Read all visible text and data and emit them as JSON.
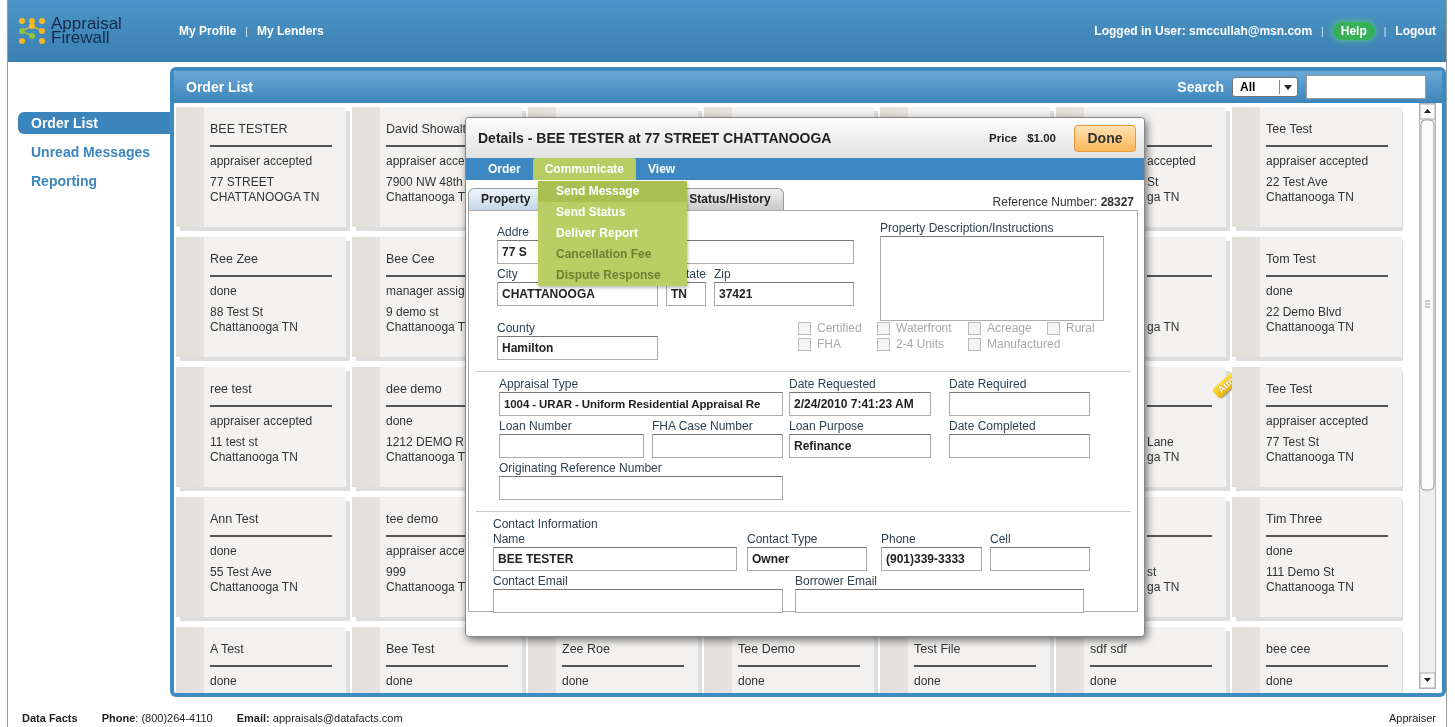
{
  "header": {
    "logo": {
      "lines": [
        "Appraisal",
        "Firewall"
      ]
    },
    "nav": [
      {
        "kind": "link",
        "label": "My Profile"
      },
      {
        "kind": "separator",
        "label": "|"
      },
      {
        "kind": "link",
        "label": "My Lenders"
      }
    ],
    "user": [
      {
        "kind": "text",
        "label": "Logged in User: smccullah@msn.com"
      },
      {
        "kind": "separator",
        "label": "|"
      },
      {
        "kind": "link",
        "label": "Help",
        "highlighted": true
      },
      {
        "kind": "separator",
        "label": "|"
      },
      {
        "kind": "link",
        "label": "Logout",
        "highlighted": false
      }
    ]
  },
  "sidebar": {
    "items": [
      {
        "label": "Order List",
        "selected": true
      },
      {
        "label": "Unread Messages",
        "selected": false
      },
      {
        "label": "Reporting",
        "selected": false
      }
    ]
  },
  "order_list": {
    "title": "Order List",
    "search": {
      "label": "Search",
      "filter": "All"
    },
    "rows": [
      {
        "cards": [
          {
            "kind": "full",
            "name": "BEE TESTER",
            "status": "appraiser accepted",
            "address": "77 STREET",
            "city": "CHATTANOOGA TN"
          },
          {
            "kind": "cut_right",
            "name": "David Showalt",
            "status": "appraiser acce",
            "address": "7900 NW 48th",
            "city": "Chattanooga T"
          },
          {
            "kind": "peek"
          },
          {
            "kind": "peek"
          },
          {
            "kind": "peek"
          },
          {
            "kind": "cut_left",
            "status": "accepted",
            "address": "St",
            "city": "ga TN"
          },
          {
            "kind": "full",
            "name": "Tee Test",
            "status": "appraiser accepted",
            "address": "22 Test Ave",
            "city": "Chattanooga TN"
          }
        ]
      },
      {
        "cards": [
          {
            "kind": "full",
            "name": "Ree Zee",
            "status": "done",
            "address": "88 Test St",
            "city": "Chattanooga TN"
          },
          {
            "kind": "cut_right",
            "name": "Bee Cee",
            "status": "manager assig",
            "address": "9 demo st",
            "city": "Chattanooga T"
          },
          {
            "kind": "covered"
          },
          {
            "kind": "covered"
          },
          {
            "kind": "covered"
          },
          {
            "kind": "cut_left",
            "city": "ga TN"
          },
          {
            "kind": "full",
            "name": "Tom Test",
            "status": "done",
            "address": "22 Demo Blvd",
            "city": "Chattanooga TN"
          }
        ]
      },
      {
        "cards": [
          {
            "kind": "full",
            "name": "ree test",
            "status": "appraiser accepted",
            "address": "11 test st",
            "city": "Chattanooga TN"
          },
          {
            "kind": "cut_right",
            "name": "dee demo",
            "status": "done",
            "address": "1212 DEMO R",
            "city": "Chattanooga T"
          },
          {
            "kind": "covered"
          },
          {
            "kind": "covered"
          },
          {
            "kind": "covered"
          },
          {
            "kind": "cut_left",
            "address": "Lane",
            "city": "ga TN",
            "badge": "Attn"
          },
          {
            "kind": "full",
            "name": "Tee Test",
            "status": "appraiser accepted",
            "address": "77 Test St",
            "city": "Chattanooga TN"
          }
        ]
      },
      {
        "cards": [
          {
            "kind": "full",
            "name": "Ann Test",
            "status": "done",
            "address": "55 Test Ave",
            "city": "Chattanooga TN"
          },
          {
            "kind": "cut_right",
            "name": "tee demo",
            "status": "appraiser acce",
            "address": "999",
            "city": "Chattanooga T"
          },
          {
            "kind": "covered"
          },
          {
            "kind": "covered"
          },
          {
            "kind": "covered"
          },
          {
            "kind": "cut_left",
            "address": "st",
            "city": "ga TN"
          },
          {
            "kind": "full",
            "name": "Tim Three",
            "status": "done",
            "address": "111 Demo St",
            "city": "Chattanooga TN"
          }
        ]
      },
      {
        "cards": [
          {
            "kind": "full",
            "name": "A Test",
            "status": "done"
          },
          {
            "kind": "full",
            "name": "Bee Test",
            "status": "done"
          },
          {
            "kind": "full",
            "name": "Zee Roe",
            "status": "done"
          },
          {
            "kind": "full",
            "name": "Tee Demo",
            "status": "done"
          },
          {
            "kind": "full",
            "name": "Test File",
            "status": "done"
          },
          {
            "kind": "full",
            "name": "sdf sdf",
            "status": "done"
          },
          {
            "kind": "full",
            "name": "bee cee",
            "status": "done"
          }
        ]
      }
    ]
  },
  "details": {
    "title": "Details - BEE TESTER at 77 STREET CHATTANOOGA",
    "price_label": "Price",
    "price": "$1.00",
    "done_button": "Done",
    "menu": [
      {
        "label": "Order",
        "selected": false
      },
      {
        "label": "Communicate",
        "selected": true
      },
      {
        "label": "View",
        "selected": false
      }
    ],
    "dropdown": [
      {
        "label": "Send Message",
        "highlighted": true,
        "disabled": false
      },
      {
        "label": "Send Status",
        "highlighted": false,
        "disabled": false
      },
      {
        "label": "Deliver Report",
        "highlighted": false,
        "disabled": false
      },
      {
        "label": "Cancellation Fee",
        "highlighted": false,
        "disabled": true
      },
      {
        "label": "Dispute Response",
        "highlighted": false,
        "disabled": true
      }
    ],
    "tabs": [
      {
        "label": "Property",
        "selected": true
      },
      {
        "label": "Status/History",
        "selected": false
      }
    ],
    "reference": "Reference Number: **28327**",
    "property": {
      "address": {
        "label": "Addre",
        "value": "77 S"
      },
      "city": {
        "label": "City",
        "value": "CHATTANOOGA"
      },
      "state": {
        "label": "tate",
        "value": "TN"
      },
      "zip": {
        "label": "Zip",
        "value": "37421"
      },
      "county": {
        "label": "County",
        "value": "Hamilton"
      },
      "description": {
        "label": "Property Description/Instructions"
      },
      "checkboxes": [
        {
          "label": "Certified",
          "checked": false,
          "disabled": true
        },
        {
          "label": "Waterfront",
          "checked": false,
          "disabled": true
        },
        {
          "label": "Acreage",
          "checked": false,
          "disabled": true
        },
        {
          "label": "Rural",
          "checked": false,
          "disabled": true
        },
        {
          "label": "FHA",
          "checked": false,
          "disabled": true
        },
        {
          "label": "2-4 Units",
          "checked": false,
          "disabled": true
        },
        {
          "label": "Manufactured",
          "checked": false,
          "disabled": true
        }
      ]
    },
    "loan": {
      "rows": [
        {
          "fields": [
            {
              "label": "Appraisal Type",
              "value": "1004 - URAR - Uniform Residential Appraisal Re"
            },
            {
              "label": "Date Requested",
              "value": "2/24/2010 7:41:23 AM"
            },
            {
              "label": "Date Required"
            }
          ]
        },
        {
          "fields": [
            {
              "label": "Loan Number"
            },
            {
              "label": "FHA Case Number"
            },
            {
              "label": "Loan Purpose",
              "value": "Refinance"
            },
            {
              "label": "Date Completed"
            }
          ]
        },
        {
          "fields": [
            {
              "label": "Originating Reference Number"
            }
          ]
        }
      ]
    },
    "contact": {
      "title": "Contact Information",
      "rows": [
        {
          "fields": [
            {
              "label": "Name",
              "value": "BEE TESTER"
            },
            {
              "label": "Contact Type",
              "value": "Owner"
            },
            {
              "label": "Phone",
              "value": "(901)339-3333"
            },
            {
              "label": "Cell"
            }
          ]
        },
        {
          "fields": [
            {
              "label": "Contact Email"
            },
            {
              "label": "Borrower Email"
            }
          ]
        }
      ]
    }
  },
  "footer": {
    "items": [
      {
        "kind": "company",
        "text": "**Data Facts**"
      },
      {
        "kind": "info",
        "text": "**Phone**: (800)264-4110"
      },
      {
        "kind": "info",
        "text": "**Email:** appraisals@datafacts.com"
      },
      {
        "kind": "right",
        "text": "Appraiser"
      }
    ]
  }
}
